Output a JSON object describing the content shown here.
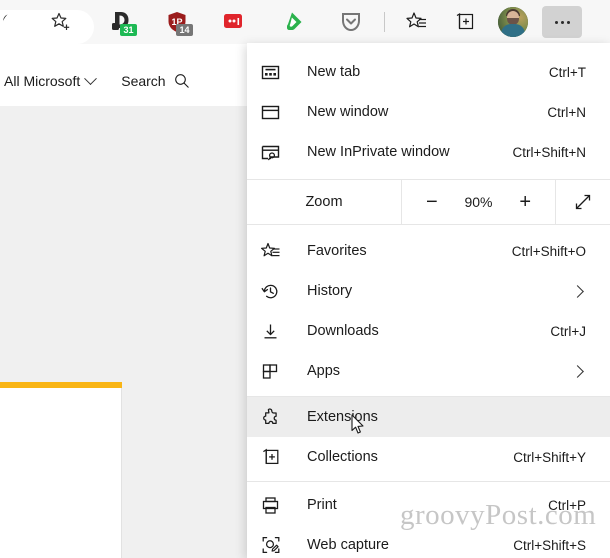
{
  "toolbar": {
    "items": [
      {
        "name": "search-icon",
        "label": "Search"
      },
      {
        "name": "add-favorite-icon",
        "label": "Add this page to favorites"
      },
      {
        "name": "extension-docs-icon",
        "label": "Docs extension",
        "badge": "31",
        "badge_color": "#1db954"
      },
      {
        "name": "extension-shield-icon",
        "label": "Shield extension",
        "badge": "14",
        "badge_color": "#767676"
      },
      {
        "name": "extension-red-icon",
        "label": "Red extension"
      },
      {
        "name": "feedly-icon",
        "label": "Feedly"
      },
      {
        "name": "pocket-icon",
        "label": "Pocket"
      },
      {
        "name": "favorites-icon",
        "label": "Favorites"
      },
      {
        "name": "collections-icon",
        "label": "Collections"
      },
      {
        "name": "profile-avatar",
        "label": "Profile"
      },
      {
        "name": "settings-and-more-button",
        "label": "Settings and more"
      }
    ]
  },
  "page": {
    "all_microsoft_label": "All Microsoft",
    "search_label": "Search",
    "accent_color": "#f9b515"
  },
  "menu": {
    "groups": [
      {
        "items": [
          {
            "label": "New tab",
            "accelerator": "Ctrl+T",
            "icon": "new-tab-icon"
          },
          {
            "label": "New window",
            "accelerator": "Ctrl+N",
            "icon": "new-window-icon"
          },
          {
            "label": "New InPrivate window",
            "accelerator": "Ctrl+Shift+N",
            "icon": "inprivate-window-icon"
          }
        ]
      }
    ],
    "zoom": {
      "label": "Zoom",
      "minus_label": "−",
      "value": "90%",
      "plus_label": "+",
      "fullscreen_name": "fullscreen-icon"
    },
    "group2": [
      {
        "label": "Favorites",
        "accelerator": "Ctrl+Shift+O",
        "icon": "favorites-icon",
        "submenu": false
      },
      {
        "label": "History",
        "accelerator": "",
        "icon": "history-icon",
        "submenu": true
      },
      {
        "label": "Downloads",
        "accelerator": "Ctrl+J",
        "icon": "downloads-icon",
        "submenu": false
      },
      {
        "label": "Apps",
        "accelerator": "",
        "icon": "apps-icon",
        "submenu": true
      }
    ],
    "group3": [
      {
        "label": "Extensions",
        "accelerator": "",
        "icon": "extensions-icon",
        "highlighted": true
      },
      {
        "label": "Collections",
        "accelerator": "Ctrl+Shift+Y",
        "icon": "collections-icon",
        "highlighted": false
      }
    ],
    "group4": [
      {
        "label": "Print",
        "accelerator": "Ctrl+P",
        "icon": "print-icon"
      },
      {
        "label": "Web capture",
        "accelerator": "Ctrl+Shift+S",
        "icon": "web-capture-icon"
      }
    ],
    "highlight_color": "#ededed"
  },
  "watermark": {
    "text": "groovyPost.com"
  }
}
